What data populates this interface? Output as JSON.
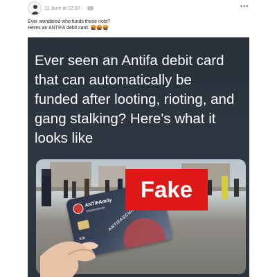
{
  "post": {
    "date": "11 June at 12:37",
    "separator": "·",
    "more_label": "•••",
    "text_lines": [
      "Ever wondered who funds these riots?",
      "Heres an ANTIFA debit card. 🤬🤬🤬"
    ]
  },
  "image": {
    "headline_lines": [
      "Ever seen an Antifa debit card",
      "that can automatically be",
      "funded after looting, rioting, and",
      "gang stalking? Here's what it",
      "looks like"
    ],
    "card": {
      "brand": "ANTIFAmily",
      "subtitle": "Mitgliedskarte",
      "arc_text": "ANTIFASCHISTISCHE",
      "number_fragment": "ICE"
    }
  },
  "label": {
    "text": "Fake"
  },
  "colors": {
    "label_red": "#de1717",
    "photo_bg": "#2d3540",
    "meta_gray": "#8a8a8a"
  }
}
